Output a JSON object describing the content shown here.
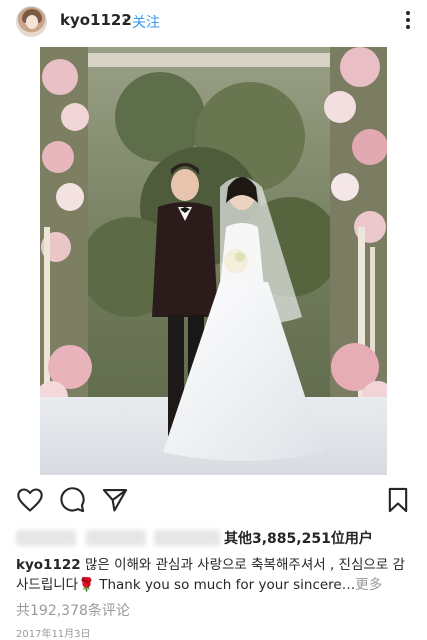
{
  "header": {
    "username": "kyo1122",
    "separator": "·",
    "follow_label": "关注",
    "avatar_icon": "profile-avatar",
    "more_icon": "more-vertical-icon"
  },
  "post": {
    "image_description_icon": "wedding-photo"
  },
  "actions": {
    "like_icon": "heart-icon",
    "comment_icon": "comment-bubble-icon",
    "share_icon": "paper-plane-icon",
    "save_icon": "bookmark-icon"
  },
  "likes": {
    "text": "其他3,885,251位用户"
  },
  "caption": {
    "username": "kyo1122",
    "text": "많은 이해와 관심과 사랑으로 축복해주셔서 , 진심으로 감사드립니다🌹 Thank you so much for your sincere…",
    "more_label": "更多"
  },
  "comments": {
    "text": "共192,378条评论"
  },
  "date": {
    "text": "2017年11月3日"
  },
  "colors": {
    "link": "#3897f0",
    "text": "#262626",
    "muted": "#9a9a9a"
  }
}
